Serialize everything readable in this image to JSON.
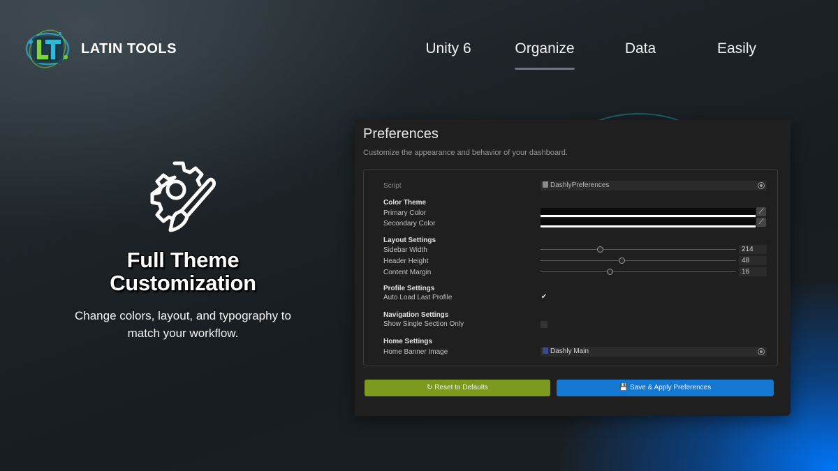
{
  "brand": {
    "name": "LATIN TOOLS",
    "logo_text": "LT"
  },
  "nav": {
    "items": [
      "Unity 6",
      "Organize",
      "Data",
      "Easily"
    ],
    "active": "Organize"
  },
  "hero": {
    "icon": "gear-paintbrush-icon",
    "title_line1": "Full Theme",
    "title_line2": "Customization",
    "subtitle": "Change colors, layout, and typography to match your workflow."
  },
  "panel": {
    "title": "Preferences",
    "description": "Customize the appearance and behavior of your dashboard.",
    "script": {
      "label": "Script",
      "value": "DashlyPreferences"
    },
    "color_theme": {
      "header": "Color Theme",
      "primary_label": "Primary Color",
      "secondary_label": "Secondary Color",
      "primary_value": "#0a0a0a",
      "secondary_value": "#0a0a0a"
    },
    "layout": {
      "header": "Layout Settings",
      "sidebar_label": "Sidebar Width",
      "sidebar_value": "214",
      "header_label": "Header Height",
      "header_value": "48",
      "margin_label": "Content Margin",
      "margin_value": "16",
      "sidebar_slider_fraction": 0.29,
      "header_slider_fraction": 0.4,
      "margin_slider_fraction": 0.34
    },
    "profile": {
      "header": "Profile Settings",
      "auto_load_label": "Auto Load Last Profile",
      "auto_load_checked": true
    },
    "navigation": {
      "header": "Navigation Settings",
      "single_section_label": "Show Single Section Only",
      "single_section_checked": false
    },
    "home": {
      "header": "Home Settings",
      "banner_label": "Home Banner Image",
      "banner_value": "Dashly Main"
    },
    "buttons": {
      "reset_icon": "↻",
      "reset": "Reset to Defaults",
      "save_icon": "💾",
      "save": "Save & Apply Preferences"
    }
  },
  "colors": {
    "accent_blue": "#1477d1",
    "reset_green": "#7c9a1e",
    "panel_bg": "#1f1f1f"
  }
}
